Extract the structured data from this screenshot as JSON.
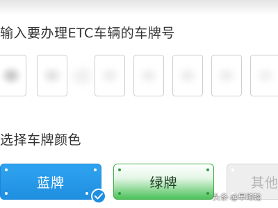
{
  "form": {
    "plate_prompt": "输入要办理ETC车辆的车牌号",
    "plate_slots": [
      "",
      "",
      "",
      "",
      "",
      "",
      ""
    ],
    "color_prompt": "选择车牌颜色"
  },
  "plate_colors": {
    "options": [
      {
        "label": "蓝牌",
        "selected": true,
        "color": "#2196F3"
      },
      {
        "label": "绿牌",
        "selected": false,
        "color": "#4CC159"
      },
      {
        "label": "其他",
        "selected": false,
        "color": "#EEEEEE"
      }
    ]
  },
  "icons": {
    "selected_check": "check-icon",
    "watermark_avatar": "avatar"
  },
  "watermark": {
    "text": "头条 @早晞翰"
  }
}
